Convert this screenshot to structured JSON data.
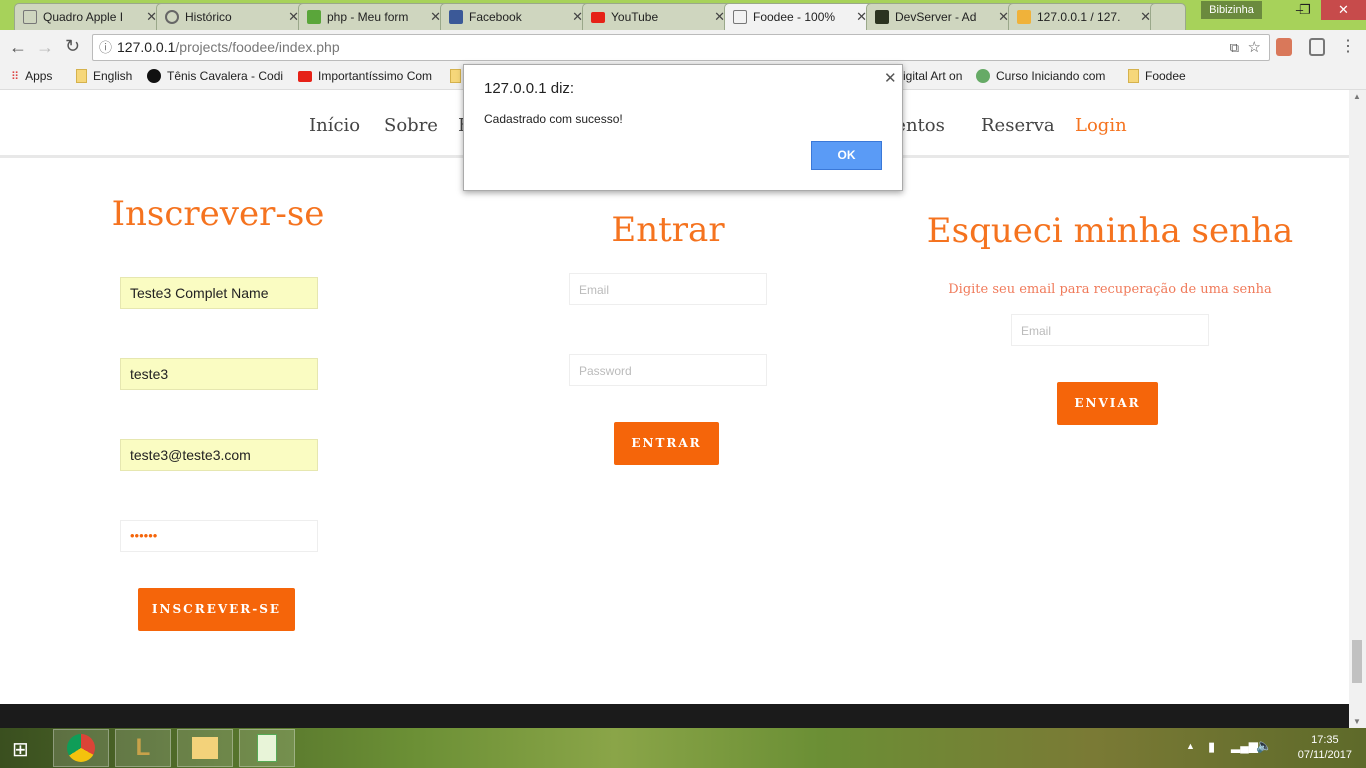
{
  "browser": {
    "tabs": [
      {
        "title": "Quadro Apple I",
        "icon": "page-icon"
      },
      {
        "title": "Histórico",
        "icon": "history-icon"
      },
      {
        "title": "php - Meu form",
        "icon": "stackoverflow-icon"
      },
      {
        "title": "Facebook",
        "icon": "facebook-icon"
      },
      {
        "title": "YouTube",
        "icon": "youtube-icon"
      },
      {
        "title": "Foodee - 100%",
        "icon": "page-icon",
        "active": true
      },
      {
        "title": "DevServer - Ad",
        "icon": "devserver-icon"
      },
      {
        "title": "127.0.0.1 / 127.",
        "icon": "phpmyadmin-icon"
      }
    ],
    "profile": "Bibizinha",
    "url_host": "127.0.0.1",
    "url_path": "/projects/foodee/index.php",
    "bookmarks": [
      "Apps",
      "English",
      "Tênis Cavalera - Codi",
      "Importantíssimo Com",
      "igital Art on",
      "Curso Iniciando com",
      "Foodee"
    ]
  },
  "site": {
    "nav": [
      "Início",
      "Sobre",
      "F",
      "Eventos",
      "Reserva",
      "Login"
    ],
    "accent": "#f5731f",
    "signup": {
      "title": "Inscrever-se",
      "name": "Teste3 Complet Name",
      "user": "teste3",
      "email": "teste3@teste3.com",
      "password": "••••••",
      "button": "INSCREVER-SE"
    },
    "login": {
      "title": "Entrar",
      "email_placeholder": "Email",
      "password_placeholder": "Password",
      "button": "ENTRAR"
    },
    "forgot": {
      "title": "Esqueci minha senha",
      "subtitle": "Digite seu email para recuperação de uma senha",
      "email_placeholder": "Email",
      "button": "ENVIAR"
    }
  },
  "dialog": {
    "title": "127.0.0.1 diz:",
    "message": "Cadastrado com sucesso!",
    "ok": "OK"
  },
  "taskbar": {
    "time": "17:35",
    "date": "07/11/2017"
  }
}
